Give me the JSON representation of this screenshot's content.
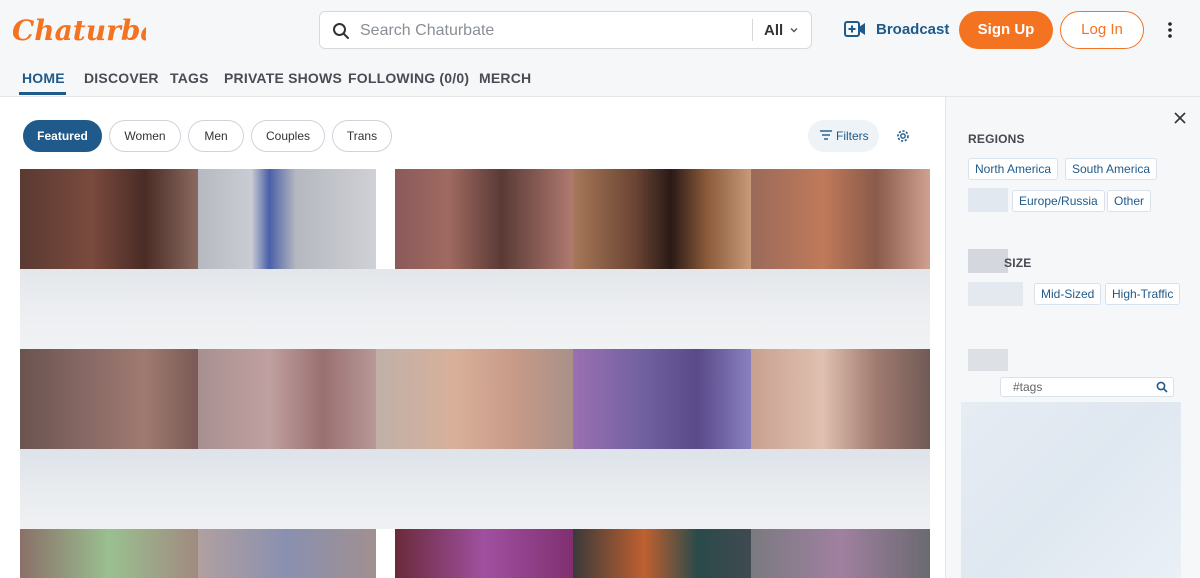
{
  "header": {
    "logo_text": "Chaturbate",
    "search_placeholder": "Search Chaturbate",
    "search_scope": "All",
    "broadcast_label": "Broadcast",
    "signup_label": "Sign Up",
    "login_label": "Log In",
    "brand_color": "#f47321",
    "accent_color": "#1f5a8a"
  },
  "nav": {
    "items": [
      {
        "label": "HOME",
        "active": true
      },
      {
        "label": "DISCOVER"
      },
      {
        "label": "TAGS"
      },
      {
        "label": "PRIVATE SHOWS"
      },
      {
        "label": "FOLLOWING (0/0)"
      },
      {
        "label": "MERCH"
      }
    ]
  },
  "filters": {
    "pills": [
      "Featured",
      "Women",
      "Men",
      "Couples",
      "Trans"
    ],
    "active": "Featured",
    "filters_label": "Filters"
  },
  "panel": {
    "regions_title": "REGIONS",
    "regions": [
      "North America",
      "South America",
      "Europe/Russia",
      "Other"
    ],
    "size_title": "SIZE",
    "sizes": [
      "Mid-Sized",
      "High-Traffic"
    ],
    "tags_placeholder": "#tags"
  }
}
